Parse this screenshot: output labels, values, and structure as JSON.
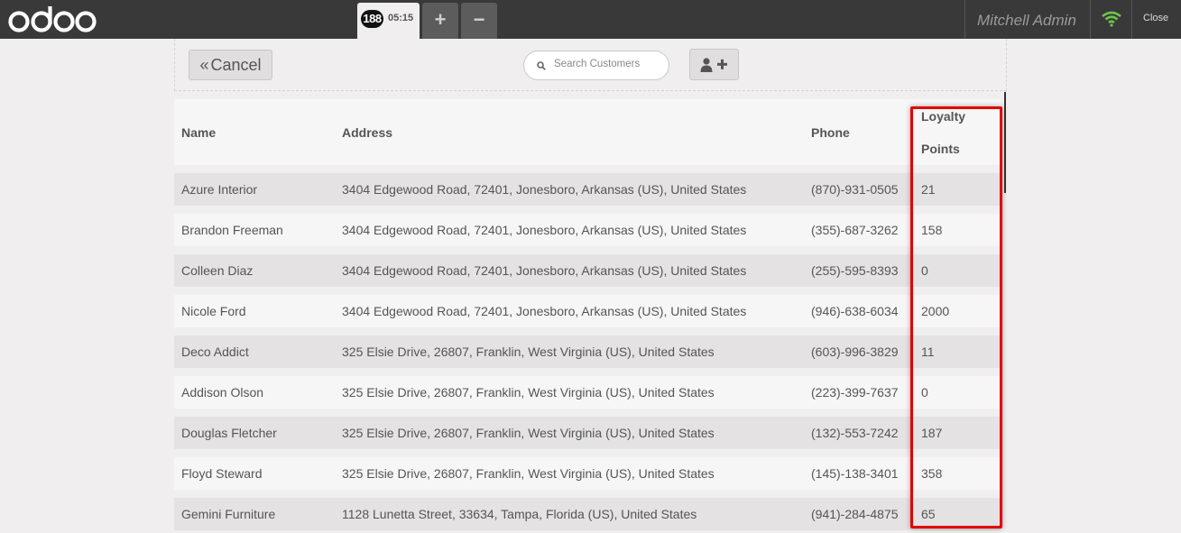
{
  "header": {
    "logo_text": "odoo",
    "order": {
      "number": "188",
      "time": "05:15"
    },
    "add_label": "+",
    "remove_label": "−",
    "user_name": "Mitchell Admin",
    "close_label": "Close",
    "icons": {
      "wifi": "wifi-icon",
      "wifi_color": "#6ec34a"
    }
  },
  "toolbar": {
    "cancel_label": "Cancel",
    "search_placeholder": "Search Customers",
    "new_customer_icon": "user-plus-icon"
  },
  "table": {
    "columns": [
      "Name",
      "Address",
      "Phone",
      "Loyalty Points"
    ],
    "loyalty_header_line1": "Loyalty",
    "loyalty_header_line2": "Points",
    "rows": [
      {
        "name": "Azure Interior",
        "address": "3404 Edgewood Road, 72401, Jonesboro, Arkansas (US), United States",
        "phone": "(870)-931-0505",
        "points": "21"
      },
      {
        "name": "Brandon Freeman",
        "address": "3404 Edgewood Road, 72401, Jonesboro, Arkansas (US), United States",
        "phone": "(355)-687-3262",
        "points": "158"
      },
      {
        "name": "Colleen Diaz",
        "address": "3404 Edgewood Road, 72401, Jonesboro, Arkansas (US), United States",
        "phone": "(255)-595-8393",
        "points": "0"
      },
      {
        "name": "Nicole Ford",
        "address": "3404 Edgewood Road, 72401, Jonesboro, Arkansas (US), United States",
        "phone": "(946)-638-6034",
        "points": "2000"
      },
      {
        "name": "Deco Addict",
        "address": "325 Elsie Drive, 26807, Franklin, West Virginia (US), United States",
        "phone": "(603)-996-3829",
        "points": "11"
      },
      {
        "name": "Addison Olson",
        "address": "325 Elsie Drive, 26807, Franklin, West Virginia (US), United States",
        "phone": "(223)-399-7637",
        "points": "0"
      },
      {
        "name": "Douglas Fletcher",
        "address": "325 Elsie Drive, 26807, Franklin, West Virginia (US), United States",
        "phone": "(132)-553-7242",
        "points": "187"
      },
      {
        "name": "Floyd Steward",
        "address": "325 Elsie Drive, 26807, Franklin, West Virginia (US), United States",
        "phone": "(145)-138-3401",
        "points": "358"
      },
      {
        "name": "Gemini Furniture",
        "address": "1128 Lunetta Street, 33634, Tampa, Florida (US), United States",
        "phone": "(941)-284-4875",
        "points": "65"
      }
    ]
  },
  "highlight": {
    "color": "#e30000",
    "target": "Loyalty Points column"
  }
}
